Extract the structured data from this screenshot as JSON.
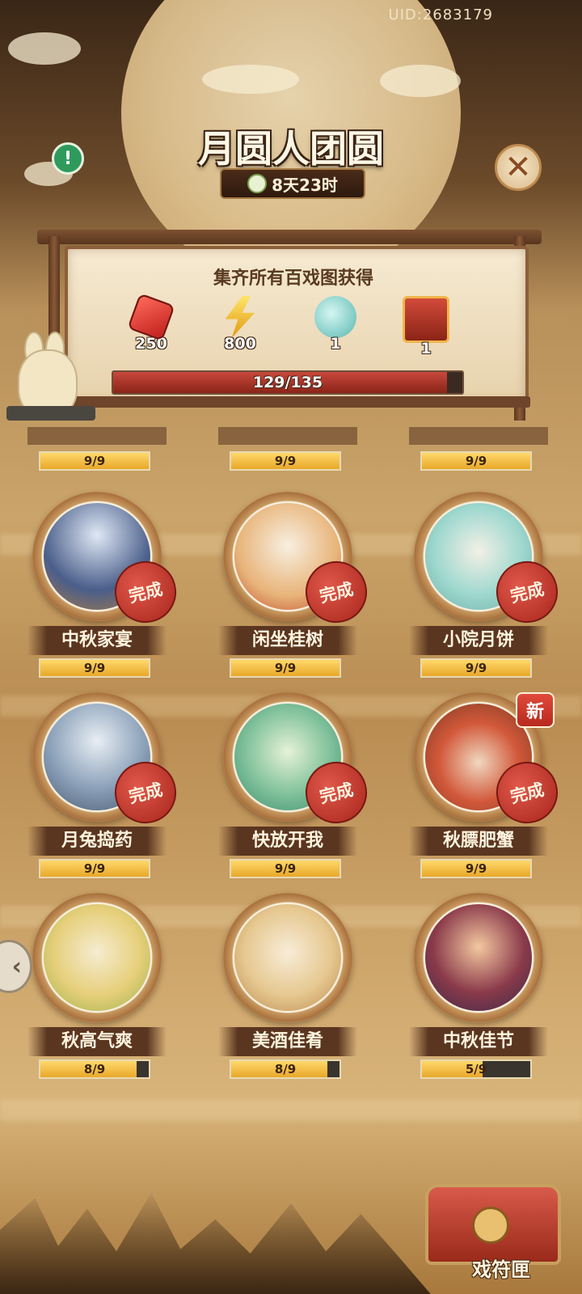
{
  "header": {
    "uid": "UID:2683179",
    "title": "月圆人团圆",
    "timer": "8天23时"
  },
  "icons": {
    "info": "info-icon",
    "close": "close-icon",
    "back": "back-arrow-icon",
    "clock": "clock-icon"
  },
  "reward_board": {
    "title": "集齐所有百戏图获得",
    "rewards": [
      {
        "icon": "ruby-icon",
        "qty": "250"
      },
      {
        "icon": "lightning-icon",
        "qty": "800"
      },
      {
        "icon": "jade-cloud-icon",
        "qty": "1"
      },
      {
        "icon": "mystery-chest-icon",
        "qty": "1"
      }
    ],
    "progress_text": "129/135",
    "progress_fraction": 0.9556
  },
  "cards_top_partial": [
    {
      "progress": "9/9",
      "fraction": 1
    },
    {
      "progress": "9/9",
      "fraction": 1
    },
    {
      "progress": "9/9",
      "fraction": 1
    }
  ],
  "cards": [
    {
      "name": "中秋家宴",
      "progress": "9/9",
      "fraction": 1,
      "stamp": "完成",
      "new": ""
    },
    {
      "name": "闲坐桂树",
      "progress": "9/9",
      "fraction": 1,
      "stamp": "完成",
      "new": ""
    },
    {
      "name": "小院月饼",
      "progress": "9/9",
      "fraction": 1,
      "stamp": "完成",
      "new": ""
    },
    {
      "name": "月兔捣药",
      "progress": "9/9",
      "fraction": 1,
      "stamp": "完成",
      "new": ""
    },
    {
      "name": "快放开我",
      "progress": "9/9",
      "fraction": 1,
      "stamp": "完成",
      "new": ""
    },
    {
      "name": "秋膘肥蟹",
      "progress": "9/9",
      "fraction": 1,
      "stamp": "完成",
      "new": "新"
    },
    {
      "name": "秋高气爽",
      "progress": "8/9",
      "fraction": 0.889,
      "stamp": "",
      "new": ""
    },
    {
      "name": "美酒佳肴",
      "progress": "8/9",
      "fraction": 0.889,
      "stamp": "",
      "new": ""
    },
    {
      "name": "中秋佳节",
      "progress": "5/9",
      "fraction": 0.556,
      "stamp": "",
      "new": ""
    }
  ],
  "chest_label": "戏符匣",
  "colors": {
    "stamp_red": "#b8301f",
    "progress_gold": "#f2c14a",
    "board_red": "#b8332a",
    "panel_cream": "#f2e4c8"
  }
}
